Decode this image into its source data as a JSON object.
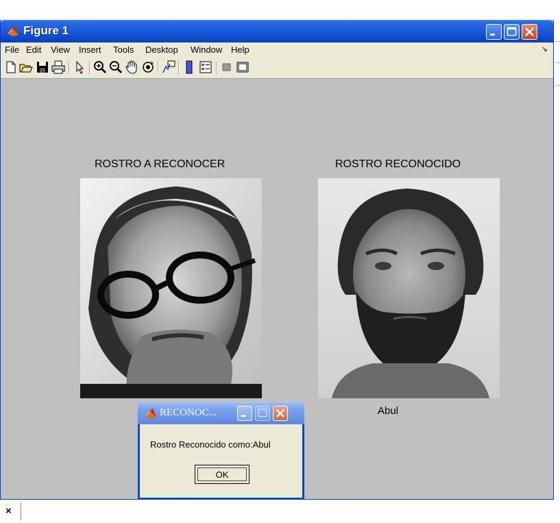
{
  "window": {
    "title": "Figure 1",
    "menu": [
      "File",
      "Edit",
      "View",
      "Insert",
      "Tools",
      "Desktop",
      "Window",
      "Help"
    ],
    "menu_arrow": "↘",
    "toolbar_icons": [
      "new-figure-icon",
      "open-file-icon",
      "save-icon",
      "print-icon",
      "edit-plot-icon",
      "zoom-in-icon",
      "zoom-out-icon",
      "pan-icon",
      "rotate-3d-icon",
      "data-cursor-icon",
      "insert-colorbar-icon",
      "insert-legend-icon",
      "hide-plot-tools-icon",
      "show-plot-tools-icon"
    ]
  },
  "figure": {
    "left_title": "ROSTRO A RECONOCER",
    "right_title": "ROSTRO RECONOCIDO",
    "recognized_name": "Abul"
  },
  "dialog": {
    "title": "RECONOC...",
    "message": "Rostro Reconocido como:Abul",
    "ok_label": "OK"
  },
  "footer": {
    "close_symbol": "×"
  },
  "colors": {
    "titlebar": "#1e5bd6",
    "figure_bg": "#c0c0c0",
    "menu_bg": "#ece9d8",
    "dialog_title": "#7aa2ec"
  }
}
